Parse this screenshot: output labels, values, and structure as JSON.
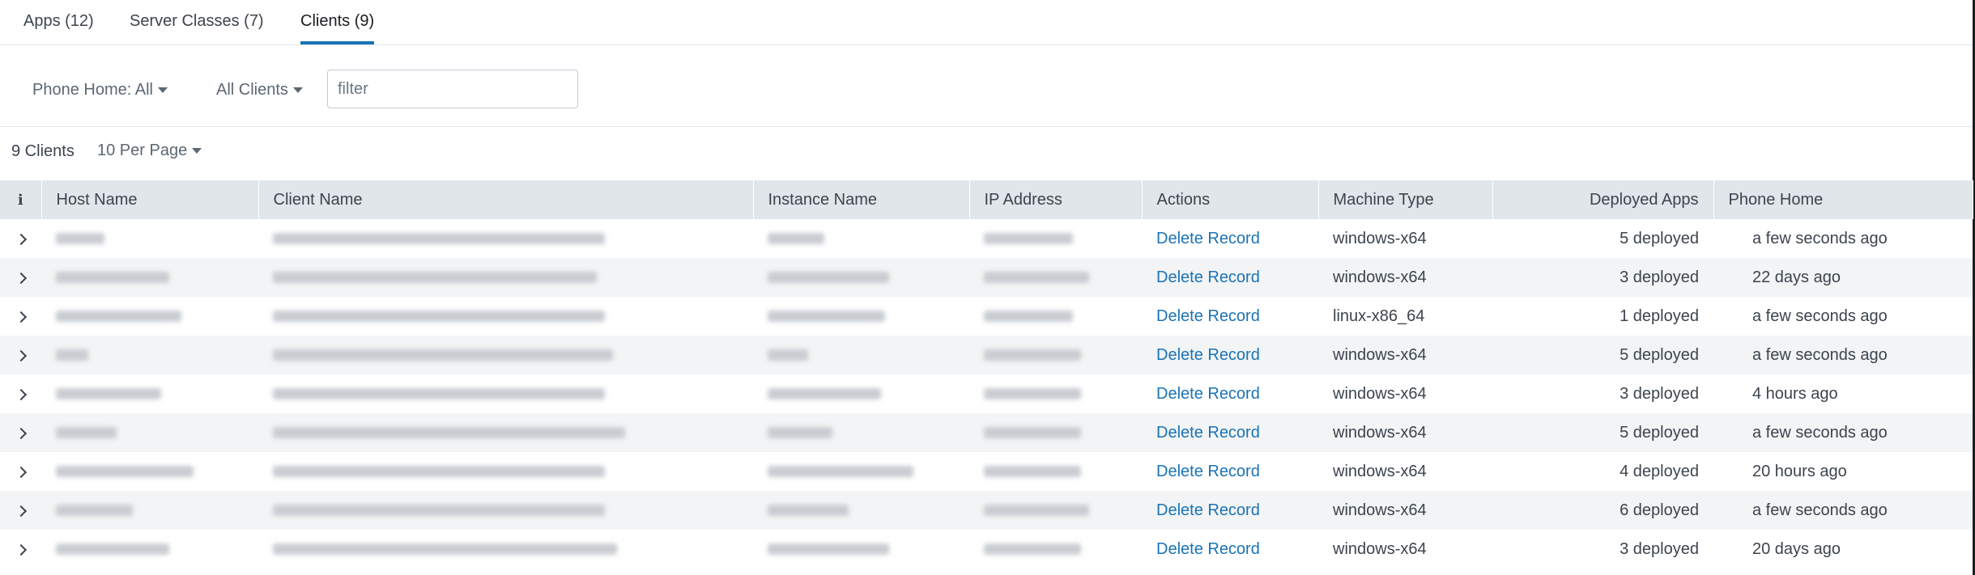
{
  "tabs": [
    {
      "label": "Apps (12)"
    },
    {
      "label": "Server Classes (7)"
    },
    {
      "label": "Clients (9)"
    }
  ],
  "toolbar": {
    "phone_home_label": "Phone Home: All",
    "clients_filter_label": "All Clients",
    "filter_placeholder": "filter"
  },
  "summary": {
    "count_label": "9 Clients",
    "per_page_label": "10 Per Page"
  },
  "table": {
    "info_header": "i",
    "columns": [
      "Host Name",
      "Client Name",
      "Instance Name",
      "IP Address",
      "Actions",
      "Machine Type",
      "Deployed Apps",
      "Phone Home"
    ],
    "rows": [
      {
        "action": "Delete Record",
        "machine_type": "windows-x64",
        "deployed": "5 deployed",
        "phone_home": "a few seconds ago"
      },
      {
        "action": "Delete Record",
        "machine_type": "windows-x64",
        "deployed": "3 deployed",
        "phone_home": "22 days ago"
      },
      {
        "action": "Delete Record",
        "machine_type": "linux-x86_64",
        "deployed": "1 deployed",
        "phone_home": "a few seconds ago"
      },
      {
        "action": "Delete Record",
        "machine_type": "windows-x64",
        "deployed": "5 deployed",
        "phone_home": "a few seconds ago"
      },
      {
        "action": "Delete Record",
        "machine_type": "windows-x64",
        "deployed": "3 deployed",
        "phone_home": "4 hours ago"
      },
      {
        "action": "Delete Record",
        "machine_type": "windows-x64",
        "deployed": "5 deployed",
        "phone_home": "a few seconds ago"
      },
      {
        "action": "Delete Record",
        "machine_type": "windows-x64",
        "deployed": "4 deployed",
        "phone_home": "20 hours ago"
      },
      {
        "action": "Delete Record",
        "machine_type": "windows-x64",
        "deployed": "6 deployed",
        "phone_home": "a few seconds ago"
      },
      {
        "action": "Delete Record",
        "machine_type": "windows-x64",
        "deployed": "3 deployed",
        "phone_home": "20 days ago"
      }
    ]
  },
  "colors": {
    "link": "#1a73b5",
    "active_tab_underline": "#1a73b5",
    "header_bg": "#e1e6eb",
    "stripe_bg": "#f2f4f5"
  }
}
